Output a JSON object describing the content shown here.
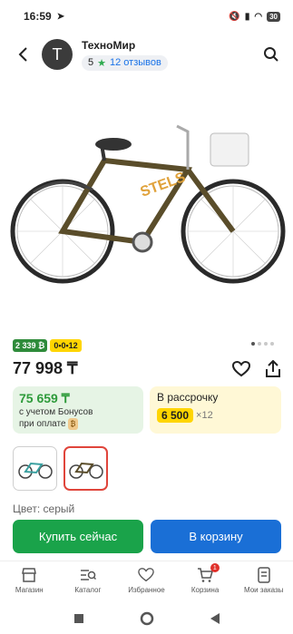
{
  "status": {
    "time": "16:59",
    "battery": "30"
  },
  "header": {
    "avatar_letter": "T",
    "shop_name": "ТехноМир",
    "rating": "5",
    "reviews": "12 отзывов"
  },
  "badges": {
    "bonus": "2 339 ₿",
    "installment": "0•0•12"
  },
  "product": {
    "price": "77 998 ₸"
  },
  "bonus_card": {
    "amount": "75 659 ₸",
    "line1": "с учетом Бонусов",
    "line2": "при оплате"
  },
  "install_card": {
    "title": "В рассрочку",
    "amount": "6 500",
    "months": "×12"
  },
  "color": {
    "label": "Цвет: серый"
  },
  "actions": {
    "buy_now": "Купить сейчас",
    "add_to_cart": "В корзину"
  },
  "nav": {
    "shop": "Магазин",
    "catalog": "Каталог",
    "favorites": "Избранное",
    "cart": "Корзина",
    "cart_count": "1",
    "orders": "Мои заказы"
  },
  "colors": {
    "accent_green": "#1aa34a",
    "accent_blue": "#1a6fd6",
    "bonus_yellow": "#ffd500"
  }
}
